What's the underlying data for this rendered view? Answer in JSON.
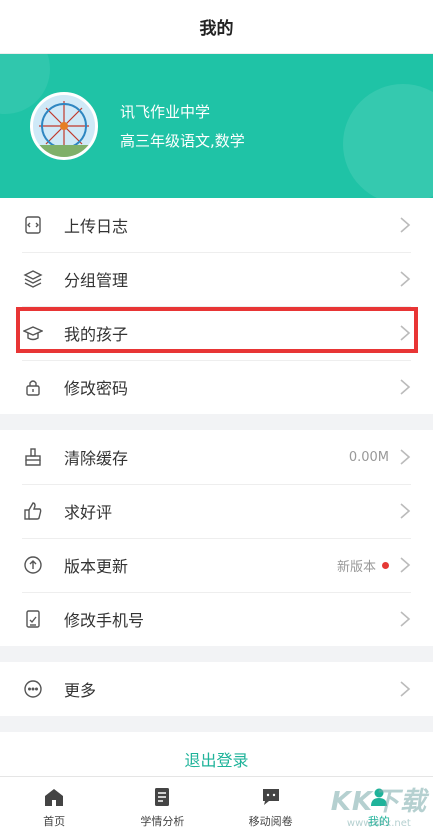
{
  "header": {
    "title": "我的"
  },
  "profile": {
    "school": "讯飞作业中学",
    "grade": "高三年级语文,数学"
  },
  "menu_group1": [
    {
      "label": "上传日志",
      "icon": "upload-log-icon"
    },
    {
      "label": "分组管理",
      "icon": "layers-icon"
    },
    {
      "label": "我的孩子",
      "icon": "graduation-cap-icon"
    },
    {
      "label": "修改密码",
      "icon": "lock-icon"
    }
  ],
  "menu_group2": [
    {
      "label": "清除缓存",
      "icon": "broom-icon",
      "extra": "0.00M"
    },
    {
      "label": "求好评",
      "icon": "thumbs-up-icon"
    },
    {
      "label": "版本更新",
      "icon": "upgrade-icon",
      "extra": "新版本"
    },
    {
      "label": "修改手机号",
      "icon": "phone-edit-icon"
    }
  ],
  "menu_group3": [
    {
      "label": "更多",
      "icon": "more-icon"
    }
  ],
  "logout": {
    "label": "退出登录"
  },
  "tabs": [
    {
      "label": "首页",
      "icon": "home-icon"
    },
    {
      "label": "学情分析",
      "icon": "report-icon"
    },
    {
      "label": "移动阅卷",
      "icon": "chat-icon"
    },
    {
      "label": "我的",
      "icon": "person-icon",
      "active": true
    }
  ],
  "watermark": {
    "big": "KK下载",
    "small": "www.kkx.net"
  },
  "colors": {
    "accent": "#1fc3a6",
    "highlight": "#e83535",
    "badge": "#e53935"
  }
}
